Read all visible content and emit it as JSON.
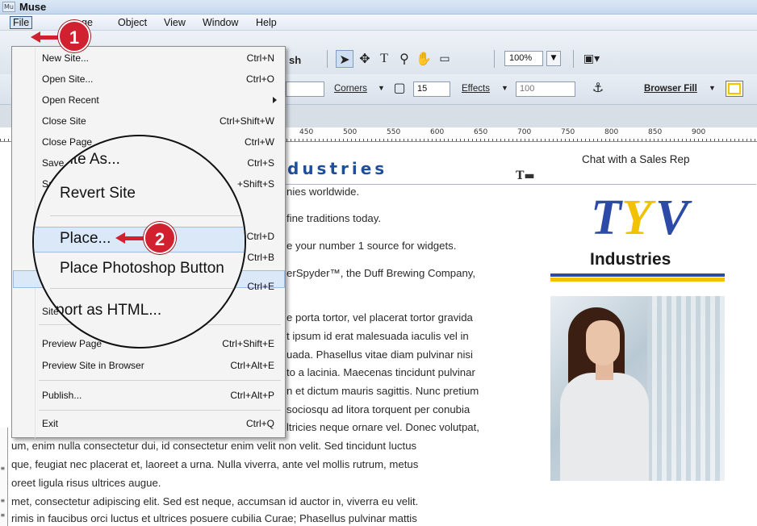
{
  "window": {
    "app_icon": "Mu",
    "title": "Muse"
  },
  "menubar": {
    "file": "File",
    "page_partial": "ge",
    "object": "Object",
    "view": "View",
    "window": "Window",
    "help": "Help"
  },
  "toolbar": {
    "publish_partial": "sh",
    "zoom_value": "100%",
    "corners_label": "Corners",
    "corners_value": "15",
    "effects_label": "Effects",
    "effects_value": "100",
    "browser_fill_label": "Browser Fill",
    "icons": [
      "selection-icon",
      "crop-icon",
      "text-icon",
      "zoom-icon",
      "hand-icon",
      "rectangle-icon",
      "preview-icon",
      "anchor-icon"
    ]
  },
  "ruler": {
    "labels": [
      "450",
      "500",
      "550",
      "600",
      "650",
      "700",
      "750",
      "800",
      "850",
      "900"
    ]
  },
  "file_menu": {
    "items": [
      {
        "label": "New Site...",
        "shortcut": "Ctrl+N"
      },
      {
        "label": "Open Site...",
        "shortcut": "Ctrl+O"
      },
      {
        "label": "Open Recent",
        "shortcut": ""
      },
      {
        "label": "Close Site",
        "shortcut": "Ctrl+Shift+W"
      },
      {
        "label": "Close Page",
        "shortcut": "Ctrl+W"
      },
      {
        "label": "Save",
        "shortcut": "Ctrl+S"
      },
      {
        "label": "Sa",
        "shortcut": "+Shift+S"
      },
      {
        "label": "",
        "shortcut": "Ctrl+D"
      },
      {
        "label": "",
        "shortcut": "Ctrl+B"
      },
      {
        "label": "",
        "shortcut": "Ctrl+E"
      },
      {
        "label": "Site",
        "shortcut": ""
      },
      {
        "label": "Preview Page",
        "shortcut": "Ctrl+Shift+E"
      },
      {
        "label": "Preview Site in Browser",
        "shortcut": "Ctrl+Alt+E"
      },
      {
        "label": "Publish...",
        "shortcut": "Ctrl+Alt+P"
      },
      {
        "label": "Exit",
        "shortcut": "Ctrl+Q"
      }
    ]
  },
  "magnifier": {
    "save_as": "ave Site As...",
    "revert": "Revert Site",
    "place": "Place...",
    "place_photoshop": "Place Photoshop Button",
    "export_html": "Export as HTML..."
  },
  "callouts": {
    "one": "1",
    "two": "2"
  },
  "page_content": {
    "heading": "dustries",
    "chat": "Chat with a Sales Rep",
    "lines": [
      "nies worldwide.",
      "fine traditions today.",
      "e your number 1 source for widgets.",
      "erSpyder™, the Duff Brewing Company,",
      "e porta tortor, vel placerat tortor gravida",
      "t ipsum id erat malesuada iaculis vel in",
      "uada. Phasellus vitae diam pulvinar nisi",
      "to a lacinia. Maecenas tincidunt pulvinar",
      "n et dictum mauris sagittis. Nunc pretium",
      "sociosqu ad litora torquent per conubia",
      "ltricies neque ornare vel. Donec volutpat,",
      "um, enim nulla consectetur dui, id consectetur enim velit non velit. Sed tincidunt luctus",
      "que, feugiat nec placerat et, laoreet a urna. Nulla viverra, ante vel mollis rutrum, metus",
      "oreet ligula risus ultrices augue.",
      "met, consectetur adipiscing elit. Sed est neque, accumsan id auctor in, viverra eu velit.",
      "rimis in faucibus orci luctus et ultrices posuere cubilia Curae; Phasellus pulvinar mattis"
    ],
    "logo_letters": [
      "T",
      "Y",
      "V"
    ],
    "logo_word": "Industries"
  },
  "colors": {
    "accent_blue": "#2d4aa6",
    "logo_yellow": "#f2c200",
    "callout_red": "#d1202f"
  }
}
